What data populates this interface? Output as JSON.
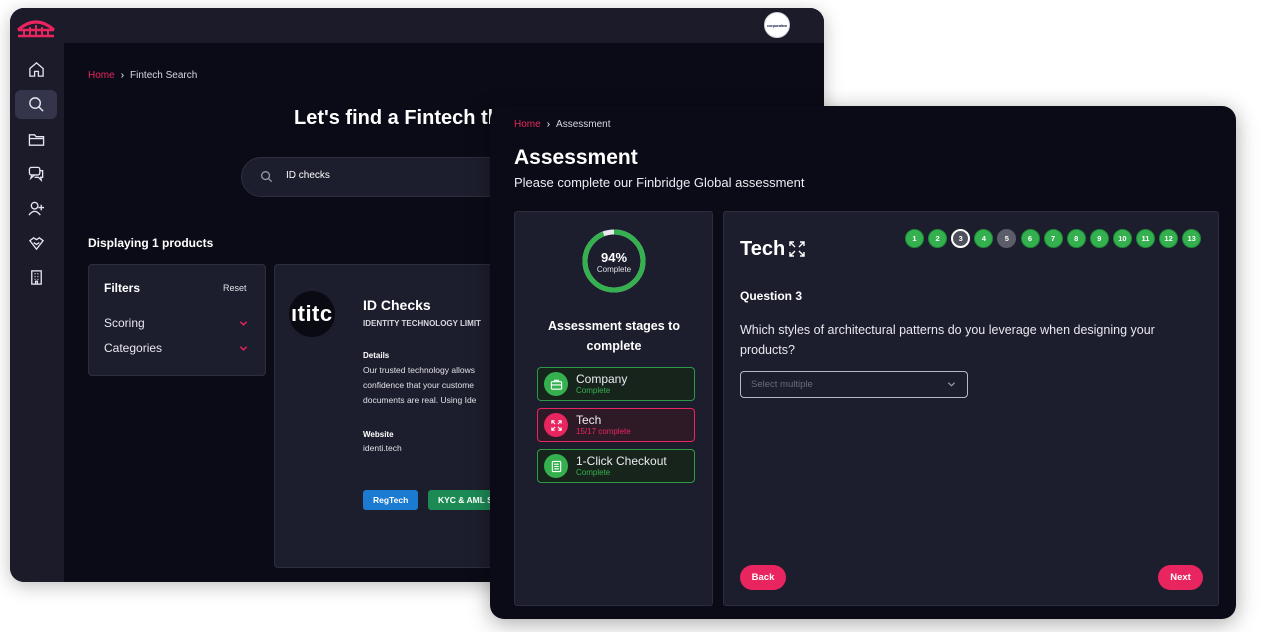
{
  "colors": {
    "accent": "#e8255e",
    "complete": "#34b04e",
    "pending": "#5b5d68",
    "regtech_tag": "#1a7bd1",
    "kyc_tag": "#1c8a55"
  },
  "back_window": {
    "avatar_text": "corporation",
    "sidebar": [
      "home-icon",
      "search-icon",
      "folder-icon",
      "chat-icon",
      "add-user-icon",
      "handshake-icon",
      "building-icon"
    ],
    "breadcrumb": {
      "home": "Home",
      "separator": "›",
      "current": "Fintech Search"
    },
    "title": "Let's find a Fintech th",
    "search": {
      "value": "ID checks",
      "icon": "search-icon"
    },
    "displaying": "Displaying 1 products",
    "filters": {
      "title": "Filters",
      "reset": "Reset",
      "items": [
        "Scoring",
        "Categories"
      ]
    },
    "product": {
      "logo_text": "ıtitc",
      "name": "ID Checks",
      "company": "IDENTITY TECHNOLOGY LIMIT",
      "details_label": "Details",
      "details_lines": [
        "Our trusted technology allows",
        "confidence that your custome",
        "documents are real. Using Ide"
      ],
      "website_label": "Website",
      "website": "identi.tech",
      "tags": [
        "RegTech",
        "KYC & AML S"
      ]
    }
  },
  "front_window": {
    "breadcrumb": {
      "home": "Home",
      "separator": "›",
      "current": "Assessment"
    },
    "title": "Assessment",
    "subtitle": "Please complete our Finbridge Global assessment",
    "progress": {
      "percent": 94,
      "percent_text": "94%",
      "label": "Complete"
    },
    "stages_title": "Assessment stages to complete",
    "stages": [
      {
        "name": "Company",
        "status": "Complete",
        "icon": "briefcase-icon",
        "state": "complete"
      },
      {
        "name": "Tech",
        "status": "15/17 complete",
        "icon": "expand-icon",
        "state": "active"
      },
      {
        "name": "1-Click Checkout",
        "status": "Complete",
        "icon": "list-icon",
        "state": "complete"
      }
    ],
    "section": "Tech",
    "questions": [
      {
        "n": "1",
        "state": "complete"
      },
      {
        "n": "2",
        "state": "complete"
      },
      {
        "n": "3",
        "state": "current"
      },
      {
        "n": "4",
        "state": "complete"
      },
      {
        "n": "5",
        "state": "pending"
      },
      {
        "n": "6",
        "state": "complete"
      },
      {
        "n": "7",
        "state": "complete"
      },
      {
        "n": "8",
        "state": "complete"
      },
      {
        "n": "9",
        "state": "complete"
      },
      {
        "n": "10",
        "state": "complete"
      },
      {
        "n": "11",
        "state": "complete"
      },
      {
        "n": "12",
        "state": "complete"
      },
      {
        "n": "13",
        "state": "complete"
      }
    ],
    "question_label": "Question 3",
    "question_text": "Which styles of architectural patterns do you leverage when designing your products?",
    "select_placeholder": "Select multiple",
    "back_label": "Back",
    "next_label": "Next"
  }
}
